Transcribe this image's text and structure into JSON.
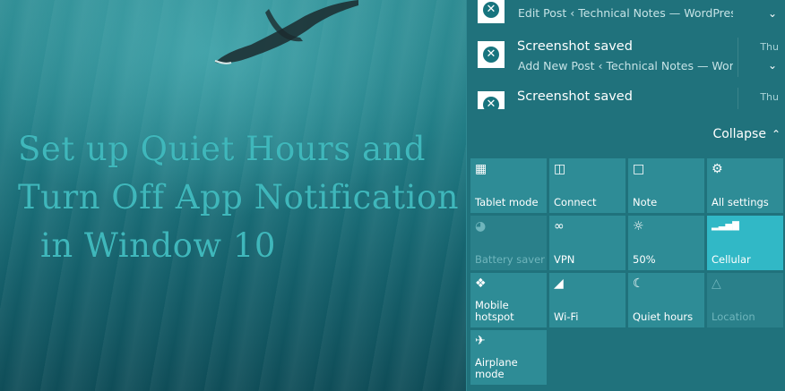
{
  "background": {
    "headline": [
      "Set up Quiet Hours and",
      "Turn Off App Notification",
      "in Window 10"
    ]
  },
  "notifications": [
    {
      "title": "",
      "subtitle": "Edit Post ‹ Technical Notes — WordPress",
      "time": "",
      "icon": "xbox-app-icon"
    },
    {
      "title": "Screenshot saved",
      "subtitle": "Add New Post ‹ Technical Notes — WordPress",
      "time": "Thu",
      "icon": "xbox-app-icon"
    },
    {
      "title": "Screenshot saved",
      "subtitle": "",
      "time": "Thu",
      "icon": "xbox-app-icon"
    }
  ],
  "collapse_label": "Collapse",
  "quick_actions": [
    {
      "label": "Tablet mode",
      "icon": "tablet-mode-icon",
      "state": "normal"
    },
    {
      "label": "Connect",
      "icon": "connect-icon",
      "state": "normal"
    },
    {
      "label": "Note",
      "icon": "note-icon",
      "state": "normal"
    },
    {
      "label": "All settings",
      "icon": "gear-icon",
      "state": "normal"
    },
    {
      "label": "Battery saver",
      "icon": "battery-saver-icon",
      "state": "disabled"
    },
    {
      "label": "VPN",
      "icon": "vpn-icon",
      "state": "normal"
    },
    {
      "label": "50%",
      "icon": "brightness-icon",
      "state": "normal"
    },
    {
      "label": "Cellular",
      "icon": "cellular-icon",
      "state": "on"
    },
    {
      "label": "Mobile\nhotspot",
      "icon": "mobile-hotspot-icon",
      "state": "normal"
    },
    {
      "label": "Wi-Fi",
      "icon": "wifi-icon",
      "state": "normal"
    },
    {
      "label": "Quiet hours",
      "icon": "moon-icon",
      "state": "normal"
    },
    {
      "label": "Location",
      "icon": "location-icon",
      "state": "disabled"
    },
    {
      "label": "Airplane mode",
      "icon": "airplane-icon",
      "state": "normal"
    }
  ],
  "colors": {
    "panel": "#20727c",
    "tile": "#2e8c96",
    "tile_active": "#31b8c6",
    "headline": "#3fb7bb"
  }
}
